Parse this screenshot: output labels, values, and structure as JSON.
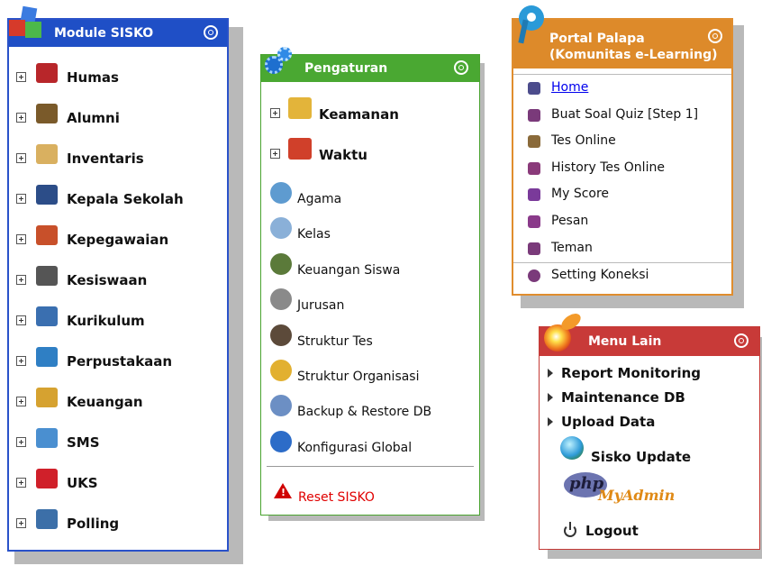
{
  "module_sisko": {
    "title": "Module SISKO",
    "items": [
      {
        "label": "Humas",
        "icon": "people-icon"
      },
      {
        "label": "Alumni",
        "icon": "graduates-icon"
      },
      {
        "label": "Inventaris",
        "icon": "boxes-icon"
      },
      {
        "label": "Kepala Sekolah",
        "icon": "principal-icon"
      },
      {
        "label": "Kepegawaian",
        "icon": "staff-icon"
      },
      {
        "label": "Kesiswaan",
        "icon": "student-icon"
      },
      {
        "label": "Kurikulum",
        "icon": "books-icon"
      },
      {
        "label": "Perpustakaan",
        "icon": "library-icon"
      },
      {
        "label": "Keuangan",
        "icon": "money-icon"
      },
      {
        "label": "SMS",
        "icon": "antenna-icon"
      },
      {
        "label": "UKS",
        "icon": "medical-cross-icon"
      },
      {
        "label": "Polling",
        "icon": "clipboard-icon"
      }
    ]
  },
  "pengaturan": {
    "title": "Pengaturan",
    "groups": [
      {
        "label": "Keamanan",
        "icon": "lock-icon"
      },
      {
        "label": "Waktu",
        "icon": "calendar-icon"
      }
    ],
    "items": [
      {
        "label": "Agama",
        "icon": "religion-icon"
      },
      {
        "label": "Kelas",
        "icon": "class-icon"
      },
      {
        "label": "Keuangan Siswa",
        "icon": "student-finance-icon"
      },
      {
        "label": "Jurusan",
        "icon": "department-icon"
      },
      {
        "label": "Struktur Tes",
        "icon": "test-structure-icon"
      },
      {
        "label": "Struktur Organisasi",
        "icon": "organization-icon"
      },
      {
        "label": "Backup & Restore DB",
        "icon": "database-icon"
      },
      {
        "label": "Konfigurasi Global",
        "icon": "book-config-icon"
      }
    ],
    "reset_label": "Reset SISKO"
  },
  "portal": {
    "title_line1": "Portal Palapa",
    "title_line2": "(Komunitas e-Learning)",
    "items": [
      {
        "label": "Home",
        "icon": "home-icon"
      },
      {
        "label": "Buat Soal Quiz   [Step 1]",
        "icon": "share-icon"
      },
      {
        "label": "Tes Online",
        "icon": "leaf-icon"
      },
      {
        "label": "History Tes Online",
        "icon": "calendar-icon"
      },
      {
        "label": "My Score",
        "icon": "star-icon"
      },
      {
        "label": "Pesan",
        "icon": "envelope-icon"
      },
      {
        "label": "Teman",
        "icon": "user-icon"
      }
    ],
    "setting_label": "Setting Koneksi"
  },
  "menu_lain": {
    "title": "Menu Lain",
    "items": [
      "Report Monitoring",
      "Maintenance DB",
      "Upload Data"
    ],
    "sisko_update": "Sisko Update",
    "php_logo_text": "php",
    "myadmin_text": "MyAdmin",
    "logout_label": "Logout"
  },
  "colors": {
    "blue_header": "#1f4fc6",
    "green_header": "#4aa832",
    "orange_header": "#dd8a2a",
    "red_header": "#c83a38",
    "link_blue": "#0000ee",
    "reset_red": "#e00000"
  }
}
